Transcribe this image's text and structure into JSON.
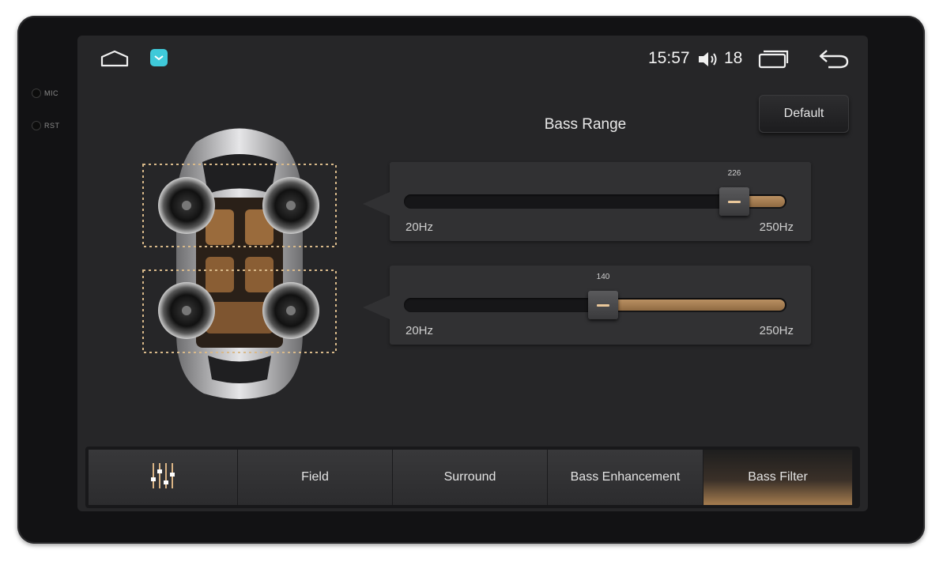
{
  "device": {
    "side_labels": [
      "MIC",
      "RST"
    ]
  },
  "statusbar": {
    "time": "15:57",
    "volume": "18",
    "icons": [
      "home-icon",
      "app-icon",
      "volume-icon",
      "recent-apps-icon",
      "back-icon"
    ],
    "accent_color": "#3fc9d9"
  },
  "main": {
    "title": "Bass Range",
    "default_button": "Default",
    "sliders": [
      {
        "value": "226",
        "value_num": 226,
        "min_label": "20Hz",
        "max_label": "250Hz",
        "min": 20,
        "max": 250
      },
      {
        "value": "140",
        "value_num": 140,
        "min_label": "20Hz",
        "max_label": "250Hz",
        "min": 20,
        "max": 250
      }
    ],
    "accent_color": "#b99062"
  },
  "tabs": [
    {
      "label": "",
      "icon": "equalizer-icon"
    },
    {
      "label": "Field"
    },
    {
      "label": "Surround"
    },
    {
      "label": "Bass Enhancement"
    },
    {
      "label": "Bass Filter",
      "active": true
    }
  ]
}
